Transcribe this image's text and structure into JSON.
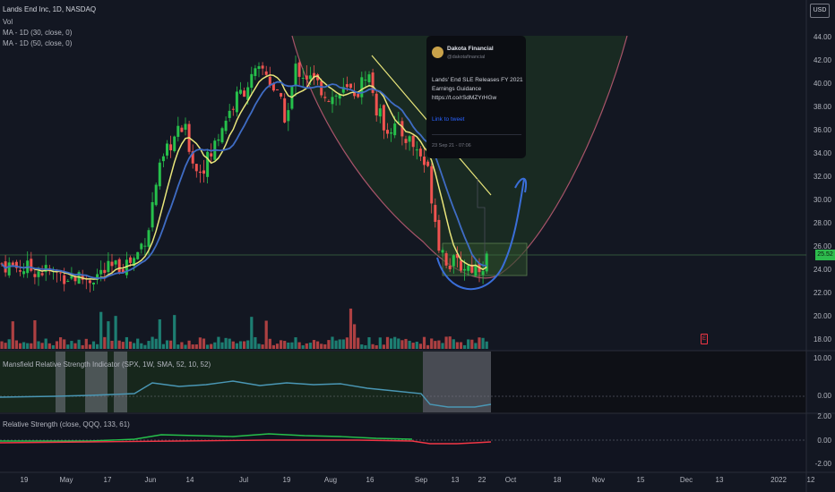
{
  "header": {
    "symbol": "Lands End Inc, 1D, NASDAQ",
    "volume": "Vol",
    "ma_fast": "MA - 1D (30, close, 0)",
    "ma_slow": "MA - 1D (50, close, 0)"
  },
  "currency": "USD",
  "price_axis": [
    "44.00",
    "42.00",
    "40.00",
    "38.00",
    "36.00",
    "34.00",
    "32.00",
    "30.00",
    "28.00",
    "26.00",
    "24.00",
    "22.00",
    "20.00",
    "18.00"
  ],
  "last_price_tag": "25.52",
  "indicators": {
    "mansfield": {
      "label": "Mansfield Relative Strength Indicator (SPX, 1W, SMA, 52, 10, 52)",
      "axis": [
        "10.00",
        "0.00"
      ]
    },
    "relative_strength": {
      "label": "Relative Strength (close, QQQ, 133, 61)",
      "axis": [
        "2.00",
        "0.00",
        "-2.00"
      ]
    }
  },
  "time_axis": [
    "19",
    "May",
    "17",
    "Jun",
    "14",
    "Jul",
    "19",
    "Aug",
    "16",
    "Sep",
    "13",
    "22",
    "Oct",
    "18",
    "Nov",
    "15",
    "Dec",
    "13",
    "2022",
    "12"
  ],
  "tweet": {
    "name": "Dakota Financial",
    "handle": "@dakotafinancial",
    "text": "Lands' End SLE Releases FY 2021 Earnings Guidance https://t.co/rSdMZYrHGw",
    "link": "Link to tweet",
    "date": "23 Sep 21 - 07:06"
  },
  "marker_label": "E",
  "colors": {
    "background": "#131722",
    "up": "#22ab94",
    "up_bright": "#26c04b",
    "down": "#ef5350",
    "ma_fast": "#e8e57a",
    "ma_slow": "#3f6cc4",
    "mansfield_line": "#4a97b5",
    "rs_line_up": "#26c04b",
    "rs_line_down": "#f23645",
    "cup_outline": "#a8546a",
    "cup_fill": "#1f3a22",
    "projection": "#3a6ed8"
  },
  "chart_data": {
    "type": "candlestick",
    "y_range": [
      17,
      45
    ],
    "last_price": 25.52
  }
}
